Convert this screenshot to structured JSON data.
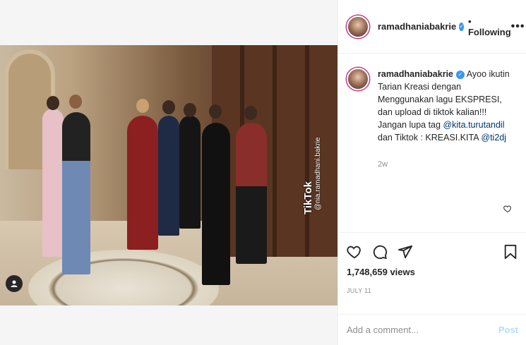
{
  "post": {
    "username": "ramadhaniabakrie",
    "follow_status": "Following",
    "separator": "•",
    "more_label": "•••",
    "verified_icon": "verified-badge-icon"
  },
  "video": {
    "watermark_brand": "TikTok",
    "watermark_handle": "@nia.ramadhani.bakrie"
  },
  "caption": {
    "username": "ramadhaniabakrie",
    "text_1": "Ayoo ikutin Tarian Kreasi dengan Menggunakan lagu EKSPRESI, dan upload di tiktok kalian!!! Jangan lupa tag",
    "mention_1": "@kita.turutandil",
    "text_2": "dan Tiktok : KREASI.KITA",
    "mention_2": "@ti2dj",
    "time_ago": "2w"
  },
  "engagement": {
    "views": "1,748,659 views",
    "date": "JULY 11"
  },
  "comment": {
    "placeholder": "Add a comment...",
    "post_label": "Post"
  },
  "colors": {
    "link": "#00376b",
    "verified": "#3897f0",
    "post_disabled": "#b2dffc",
    "muted": "#8e8e8e"
  }
}
